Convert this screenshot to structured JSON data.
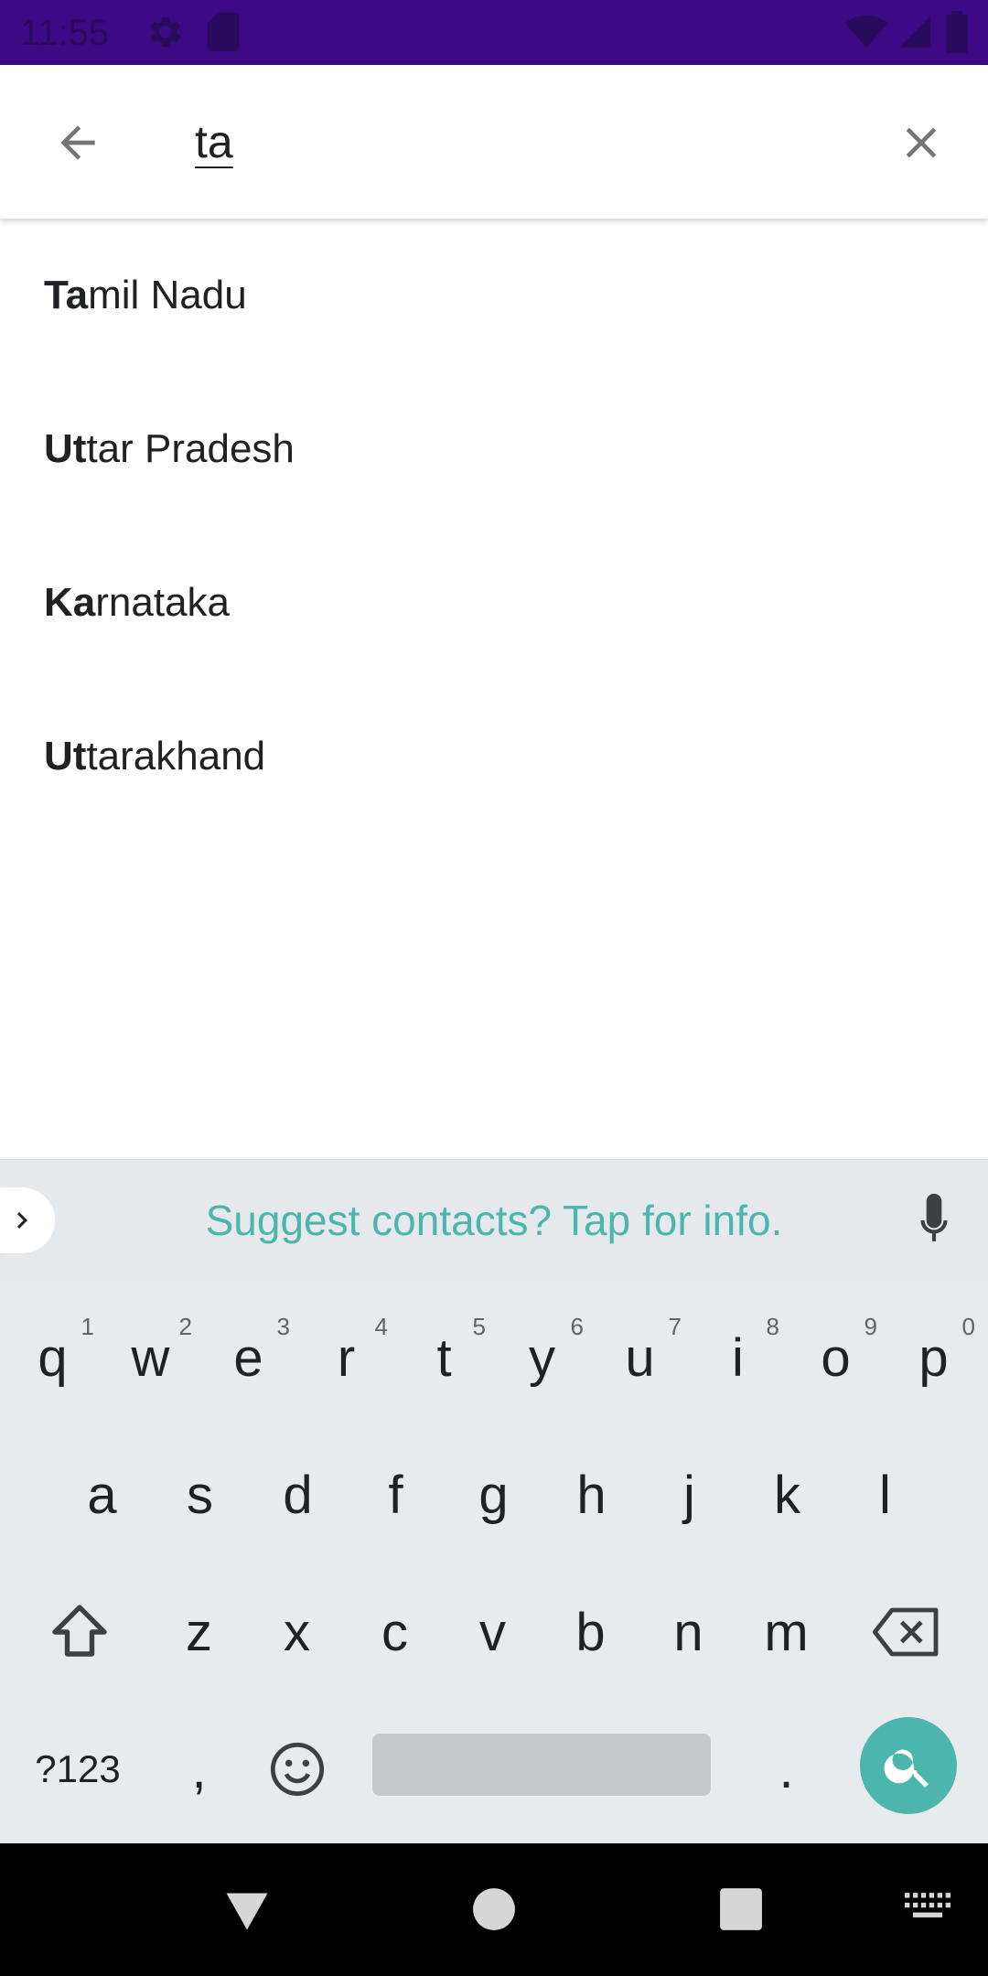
{
  "status_bar": {
    "time": "11:55",
    "icons": [
      "settings-icon",
      "sd-card-icon",
      "wifi-icon",
      "signal-icon",
      "battery-icon"
    ]
  },
  "search": {
    "query": "ta",
    "back_icon": "arrow-back-icon",
    "clear_icon": "close-icon"
  },
  "suggestions": [
    {
      "bold": "Ta",
      "rest": "mil Nadu"
    },
    {
      "bold": "Ut",
      "rest": "tar Pradesh"
    },
    {
      "bold": "Ka",
      "rest": "rnataka"
    },
    {
      "bold": "Ut",
      "rest": "tarakhand"
    }
  ],
  "keyboard": {
    "suggestion_strip": "Suggest contacts? Tap for info.",
    "row1": [
      {
        "key": "q",
        "sup": "1"
      },
      {
        "key": "w",
        "sup": "2"
      },
      {
        "key": "e",
        "sup": "3"
      },
      {
        "key": "r",
        "sup": "4"
      },
      {
        "key": "t",
        "sup": "5"
      },
      {
        "key": "y",
        "sup": "6"
      },
      {
        "key": "u",
        "sup": "7"
      },
      {
        "key": "i",
        "sup": "8"
      },
      {
        "key": "o",
        "sup": "9"
      },
      {
        "key": "p",
        "sup": "0"
      }
    ],
    "row2": [
      "a",
      "s",
      "d",
      "f",
      "g",
      "h",
      "j",
      "k",
      "l"
    ],
    "row3": [
      "z",
      "x",
      "c",
      "v",
      "b",
      "n",
      "m"
    ],
    "symbols_label": "?123",
    "comma": ",",
    "period": ".",
    "accent_color": "#4db6ac"
  },
  "colors": {
    "status_bar": "#3b0a84",
    "keyboard_bg": "#e8ebee"
  }
}
